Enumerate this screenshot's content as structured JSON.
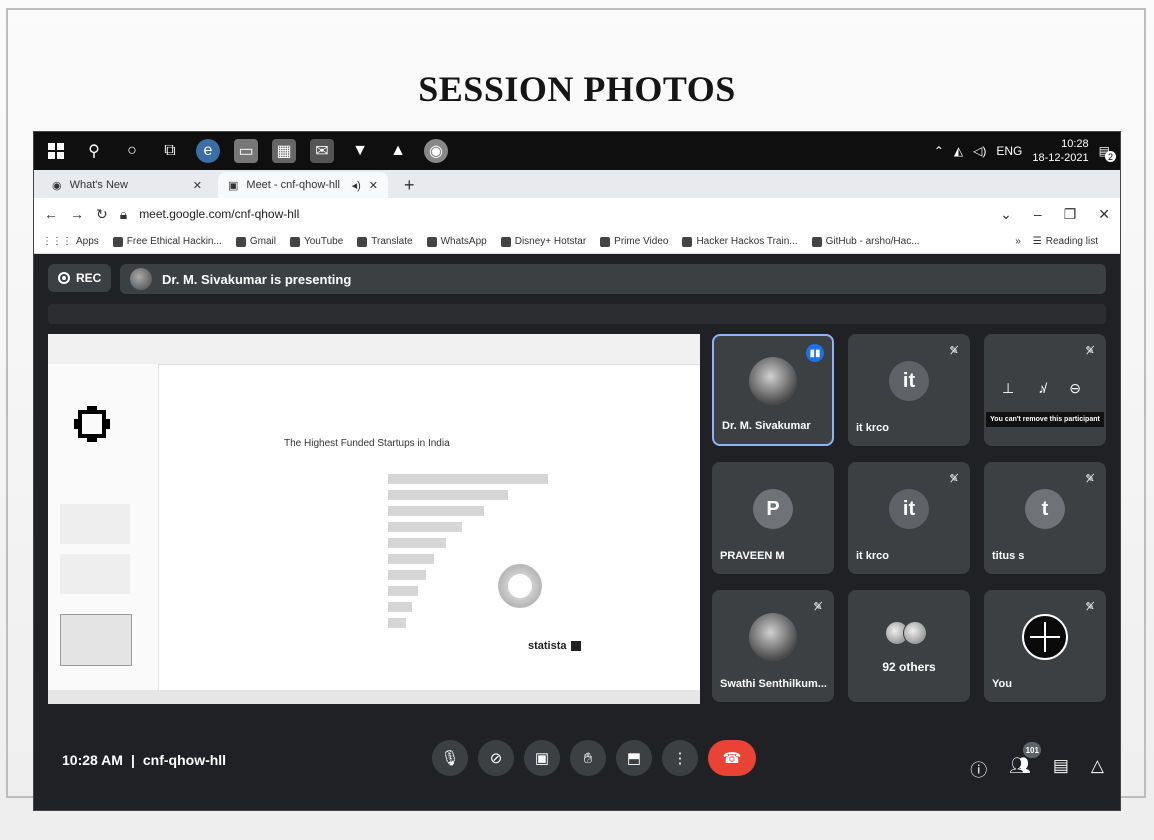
{
  "page": {
    "title": "SESSION PHOTOS"
  },
  "taskbar": {
    "icons": [
      "windows-icon",
      "search-icon",
      "cortana-icon",
      "task-view-icon",
      "edge-icon",
      "explorer-icon",
      "store-icon",
      "mail-icon",
      "brave-icon",
      "vlc-icon",
      "chrome-icon"
    ],
    "tray_lang": "ENG",
    "time": "10:28",
    "date": "18-12-2021",
    "notification_count": "2"
  },
  "browser": {
    "tabs": [
      {
        "label": "What's New"
      },
      {
        "label": "Meet - cnf-qhow-hll"
      }
    ],
    "url": "meet.google.com/cnf-qhow-hll",
    "bookmarks": [
      "Apps",
      "Free Ethical Hackin...",
      "Gmail",
      "YouTube",
      "Translate",
      "WhatsApp",
      "Disney+ Hotstar",
      "Prime Video",
      "Hacker Hackos Train...",
      "GitHub - arsho/Hac..."
    ],
    "reading_list": "Reading list"
  },
  "meet": {
    "rec_label": "REC",
    "presenting_text": "Dr. M. Sivakumar is presenting",
    "shared_screen": {
      "chart_title": "The Highest Funded Startups in India",
      "statista_label": "statista"
    },
    "participants": [
      {
        "name": "Dr. M. Sivakumar",
        "initial": "",
        "type": "photo",
        "muted": false,
        "speaking": true
      },
      {
        "name": "it krco",
        "initial": "it",
        "type": "letter",
        "muted": true
      },
      {
        "name": "",
        "initial": "",
        "type": "hover",
        "muted": true,
        "tooltip": "You can't remove this participant"
      },
      {
        "name": "PRAVEEN M",
        "initial": "P",
        "type": "letter",
        "muted": false
      },
      {
        "name": "it krco",
        "initial": "it",
        "type": "letter",
        "muted": true
      },
      {
        "name": "titus s",
        "initial": "t",
        "type": "letter",
        "muted": true
      },
      {
        "name": "Swathi Senthilkum...",
        "initial": "",
        "type": "photo",
        "muted": true
      },
      {
        "name": "92 others",
        "initial": "",
        "type": "others",
        "muted": false
      },
      {
        "name": "You",
        "initial": "",
        "type": "you",
        "muted": true
      }
    ],
    "meeting_time": "10:28 AM",
    "separator": "|",
    "meeting_code": "cnf-qhow-hll",
    "participant_count": "101"
  }
}
